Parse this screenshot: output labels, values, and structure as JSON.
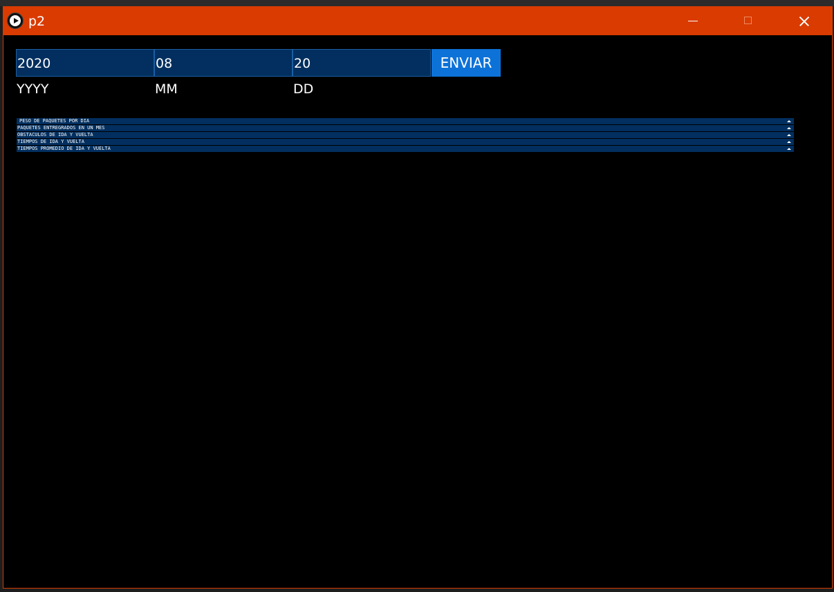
{
  "window": {
    "title": "p2"
  },
  "form": {
    "year_value": "2020",
    "month_value": "08",
    "day_value": "20",
    "year_label": "YYYY",
    "month_label": "MM",
    "day_label": "DD",
    "submit_label": "ENVIAR"
  },
  "groups": [
    {
      "label": "PESO DE PAQUETES POR DIA"
    },
    {
      "label": "PAQUETES ENTREGRADOS EN UN MES"
    },
    {
      "label": "OBSTACULOS DE IDA Y VUELTA"
    },
    {
      "label": "TIEMPOS DE IDA Y VUELTA"
    },
    {
      "label": "TIEMPOS PROMEDIO DE IDA Y VUELTA"
    }
  ],
  "colors": {
    "titlebar": "#da3b01",
    "field_bg": "#022f5f",
    "button_bg": "#0d72d8",
    "canvas_bg": "#000000"
  }
}
